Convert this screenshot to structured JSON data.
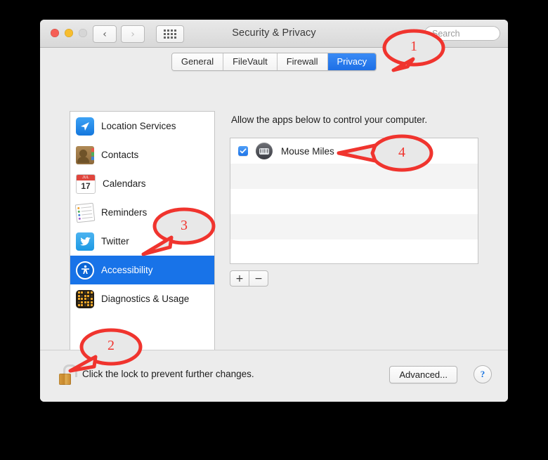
{
  "window": {
    "title": "Security & Privacy",
    "traffic_lights": [
      "close-red",
      "minimize-yellow",
      "zoom-disabled-gray"
    ],
    "nav": {
      "back": "‹",
      "forward": "›",
      "show_all": "grid-icon"
    },
    "search": {
      "placeholder": "Search",
      "value": ""
    }
  },
  "tabs": [
    {
      "label": "General",
      "active": false
    },
    {
      "label": "FileVault",
      "active": false
    },
    {
      "label": "Firewall",
      "active": false
    },
    {
      "label": "Privacy",
      "active": true
    }
  ],
  "sidebar": {
    "items": [
      {
        "label": "Location Services",
        "icon": "location-services-icon",
        "selected": false
      },
      {
        "label": "Contacts",
        "icon": "contacts-icon",
        "selected": false
      },
      {
        "label": "Calendars",
        "icon": "calendar-icon",
        "selected": false
      },
      {
        "label": "Reminders",
        "icon": "reminders-icon",
        "selected": false
      },
      {
        "label": "Twitter",
        "icon": "twitter-icon",
        "selected": false
      },
      {
        "label": "Accessibility",
        "icon": "accessibility-icon",
        "selected": true
      },
      {
        "label": "Diagnostics & Usage",
        "icon": "diagnostics-icon",
        "selected": false
      }
    ],
    "calendar_icon": {
      "month": "JUL",
      "day": "17"
    }
  },
  "main": {
    "description": "Allow the apps below to control your computer.",
    "apps": [
      {
        "name": "Mouse Miles",
        "checked": true,
        "icon": "mouse-miles-app-icon"
      }
    ],
    "empty_rows": 4,
    "add_label": "+",
    "remove_label": "−"
  },
  "bottom": {
    "lock_icon": "unlocked-padlock-icon",
    "lock_text": "Click the lock to prevent further changes.",
    "advanced_label": "Advanced...",
    "help_label": "?"
  },
  "annotations": [
    {
      "number": "1",
      "target": "privacy-tab"
    },
    {
      "number": "2",
      "target": "lock-button"
    },
    {
      "number": "3",
      "target": "accessibility-sidebar-item"
    },
    {
      "number": "4",
      "target": "mouse-miles-row"
    }
  ],
  "colors": {
    "accent_blue": "#1873e8",
    "tab_active": "#2b7ff0",
    "annotation_red": "#f0342e",
    "window_bg": "#ececec"
  }
}
